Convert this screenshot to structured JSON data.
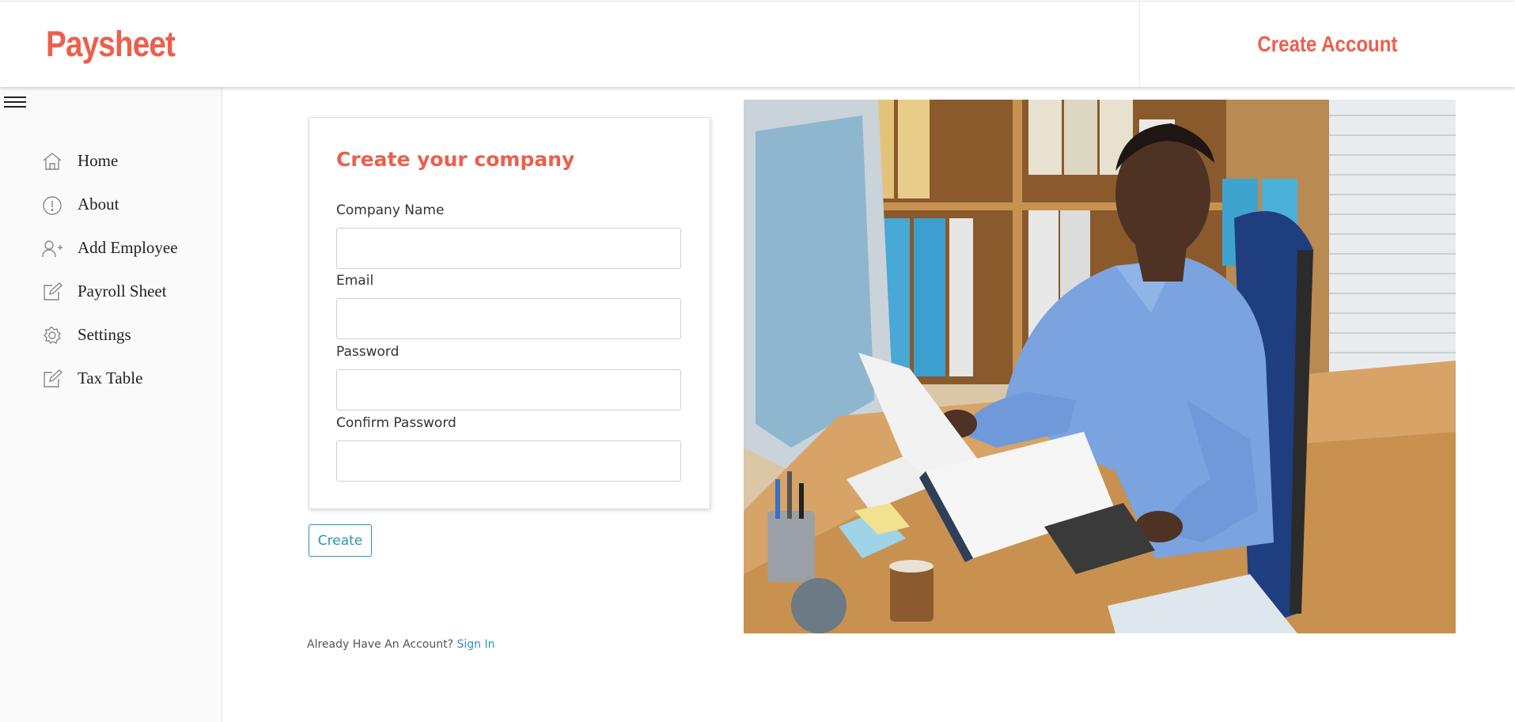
{
  "header": {
    "brand": "Paysheet",
    "create_account_label": "Create Account"
  },
  "sidebar": {
    "items": [
      {
        "label": "Home",
        "icon": "home-icon"
      },
      {
        "label": "About",
        "icon": "info-icon"
      },
      {
        "label": "Add Employee",
        "icon": "add-user-icon"
      },
      {
        "label": "Payroll Sheet",
        "icon": "edit-icon"
      },
      {
        "label": "Settings",
        "icon": "gear-icon"
      },
      {
        "label": "Tax Table",
        "icon": "edit-icon"
      }
    ]
  },
  "form": {
    "title": "Create your company",
    "fields": [
      {
        "label": "Company Name",
        "value": ""
      },
      {
        "label": "Email",
        "value": ""
      },
      {
        "label": "Password",
        "value": ""
      },
      {
        "label": "Confirm Password",
        "value": ""
      }
    ],
    "submit_label": "Create"
  },
  "footer": {
    "prompt": "Already Have An Account?",
    "signin_label": "Sign In"
  },
  "colors": {
    "accent": "#ec5f4c",
    "link": "#2e8fbf",
    "sidebar_bg": "#fafafa"
  }
}
